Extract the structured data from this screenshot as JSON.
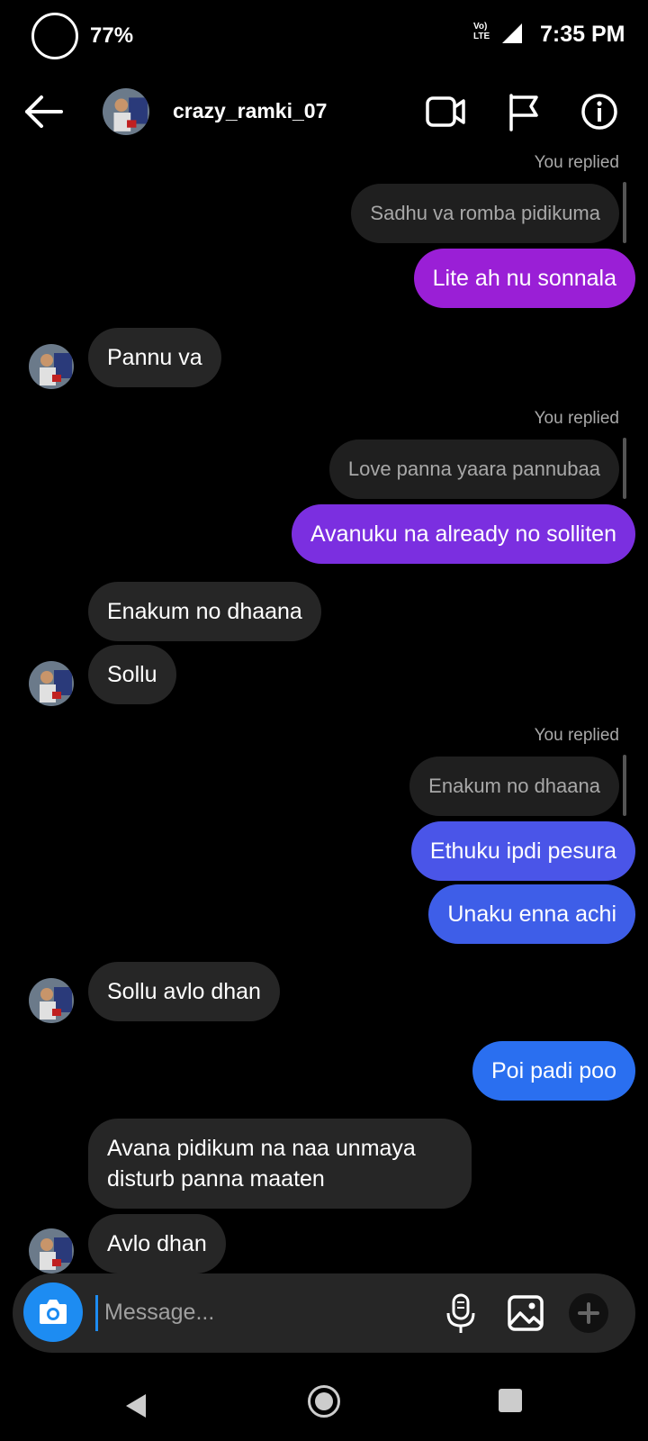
{
  "status_bar": {
    "battery": "77%",
    "network": "Vo) LTE",
    "time": "7:35 PM"
  },
  "header": {
    "username": "crazy_ramki_07"
  },
  "thread": {
    "reply_label": "You replied",
    "messages": [
      {
        "reply_quote": "Sadhu va romba pidikuma",
        "text": "Lite ah nu sonnala",
        "color": "#9a1fd6"
      },
      {
        "text": "Pannu va"
      },
      {
        "reply_quote": "Love panna yaara pannubaa",
        "text": "Avanuku na already no solliten",
        "color": "#7b2fe0"
      },
      {
        "text": "Enakum no dhaana"
      },
      {
        "text": "Sollu"
      },
      {
        "reply_quote": "Enakum no dhaana",
        "text": "Ethuku ipdi pesura",
        "color": "#4a55e8"
      },
      {
        "text": "Unaku enna achi",
        "color": "#3e5ee8"
      },
      {
        "text": "Sollu avlo dhan"
      },
      {
        "text": "Poi padi poo",
        "color": "#2a6ff0"
      },
      {
        "text": "Avana pidikum na naa unmaya disturb panna maaten"
      },
      {
        "text": "Avlo dhan"
      }
    ]
  },
  "composer": {
    "placeholder": "Message..."
  },
  "colors": {
    "incoming": "#262626",
    "camera": "#1d8cf2"
  }
}
